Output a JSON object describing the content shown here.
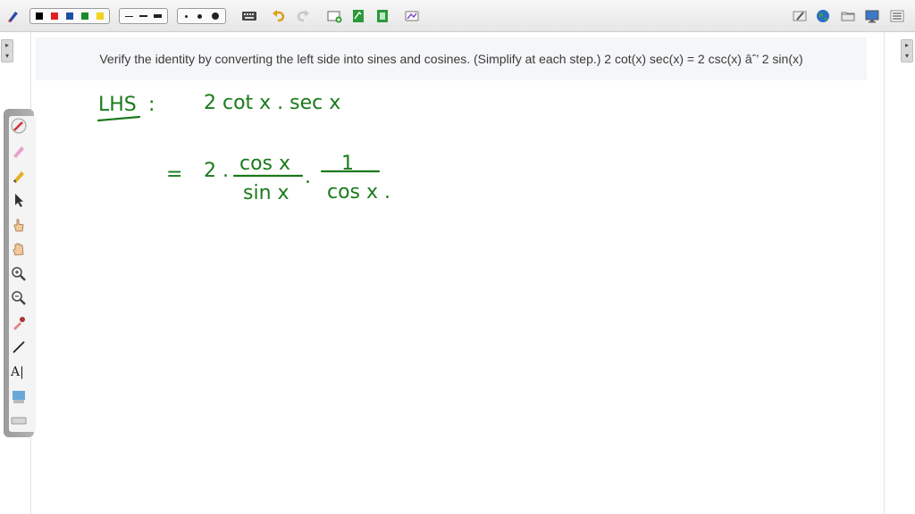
{
  "question": {
    "text": "Verify the identity by converting the left side into sines and cosines. (Simplify at each step.) 2 cot(x) sec(x) = 2 csc(x) âˆ’ 2 sin(x)"
  },
  "toolbar": {
    "colors": [
      "#000000",
      "#e02020",
      "#1f4fa0",
      "#1a8a2a",
      "#f2d21a"
    ]
  },
  "palette": {
    "text_tool_label": "A|"
  },
  "handwriting": {
    "ink_color": "#1a7a1a",
    "line1_label": "LHS",
    "line1_colon": ":",
    "line1_expr": "2 cot x . sec x",
    "line2_equals": "=",
    "line2_coef": "2 .",
    "frac1_num": "cos x",
    "frac1_den": "sin x",
    "dot": ".",
    "frac2_num": "1",
    "frac2_den": "cos x ."
  }
}
